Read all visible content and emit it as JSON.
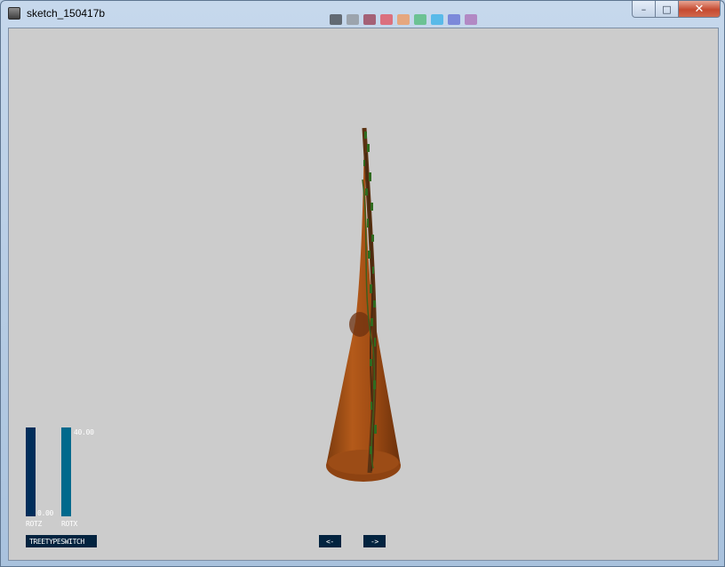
{
  "window": {
    "title": "sketch_150417b",
    "controls": {
      "minimize": "–",
      "maximize": "□",
      "close": "✕"
    }
  },
  "background_swatches": [
    "#111111",
    "#7a7a7a",
    "#880015",
    "#ed1c24",
    "#ff7f27",
    "#22b14c",
    "#00a2e8",
    "#3f48cc",
    "#a349a4"
  ],
  "controls": {
    "rotz": {
      "label": "ROTZ",
      "value": "0.00",
      "fill_fraction": 0.0
    },
    "rotx": {
      "label": "ROTX",
      "value": "40.00",
      "fill_fraction": 1.0
    },
    "treetype_button": {
      "label": "TREETYPESWITCH"
    },
    "prev_button": {
      "label": "<-"
    },
    "next_button": {
      "label": "->"
    }
  },
  "colors": {
    "canvas_bg": "#cccccc",
    "slider_bg": "#002d5a",
    "slider_fg": "#00698c",
    "button_bg": "#02233f",
    "cone": "#9a4a14",
    "foliage": "#2f6b1f"
  }
}
